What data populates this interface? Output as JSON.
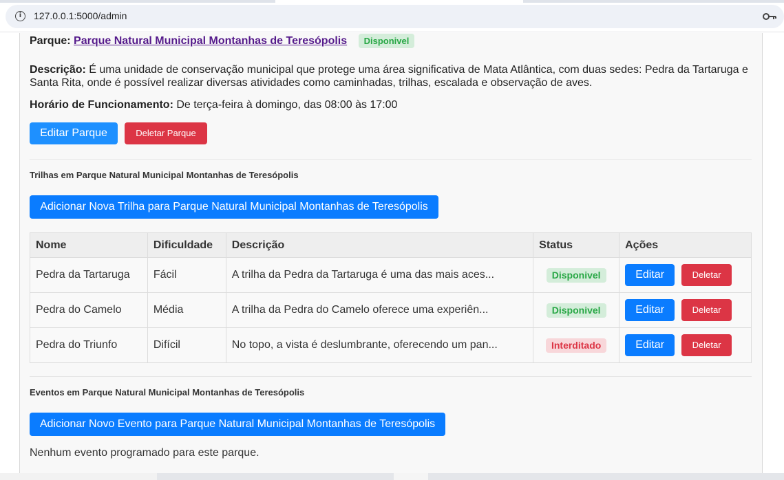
{
  "browser": {
    "url": "127.0.0.1:5000/admin"
  },
  "park": {
    "label": "Parque:",
    "name": "Parque Natural Municipal Montanhas de Teresópolis",
    "status": "Disponivel",
    "description_label": "Descrição:",
    "description": "É uma unidade de conservação municipal que protege uma área significativa de Mata Atlântica, com duas sedes: Pedra da Tartaruga e Santa Rita, onde é possível realizar diversas atividades como caminhadas, trilhas, escalada e observação de aves.",
    "hours_label": "Horário de Funcionamento:",
    "hours": "De terça-feira à domingo, das 08:00 às 17:00",
    "edit_button": "Editar Parque",
    "delete_button": "Deletar Parque"
  },
  "trails": {
    "heading": "Trilhas em Parque Natural Municipal Montanhas de Teresópolis",
    "add_button": "Adicionar Nova Trilha para Parque Natural Municipal Montanhas de Teresópolis",
    "columns": [
      "Nome",
      "Dificuldade",
      "Descrição",
      "Status",
      "Ações"
    ],
    "rows": [
      {
        "name": "Pedra da Tartaruga",
        "difficulty": "Fácil",
        "description": "A trilha da Pedra da Tartaruga é uma das mais aces...",
        "status": "Disponivel",
        "edit": "Editar",
        "delete": "Deletar"
      },
      {
        "name": "Pedra do Camelo",
        "difficulty": "Média",
        "description": "A trilha da Pedra do Camelo oferece uma experiên...",
        "status": "Disponivel",
        "edit": "Editar",
        "delete": "Deletar"
      },
      {
        "name": "Pedra do Triunfo",
        "difficulty": "Difícil",
        "description": "No topo, a vista é deslumbrante, oferecendo um pan...",
        "status": "Interditado",
        "edit": "Editar",
        "delete": "Deletar"
      }
    ]
  },
  "events": {
    "heading": "Eventos em Parque Natural Municipal Montanhas de Teresópolis",
    "add_button": "Adicionar Novo Evento para Parque Natural Municipal Montanhas de Teresópolis",
    "empty_text": "Nenhum evento programado para este parque."
  },
  "colors": {
    "primary": "#0a7cff",
    "danger": "#dc3545",
    "success_bg": "#d4edda",
    "success_text": "#28a745",
    "danger_bg": "#f8d7da",
    "link": "#551a8b"
  },
  "icons": [
    "info-icon",
    "key-icon"
  ]
}
